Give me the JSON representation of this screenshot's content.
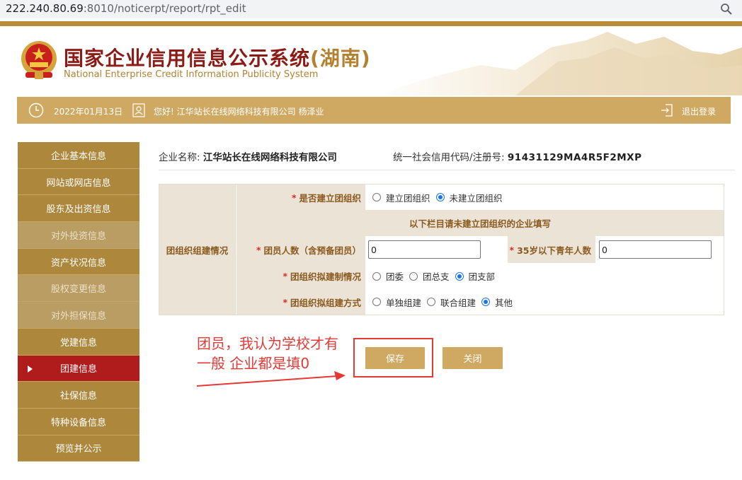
{
  "browser": {
    "url_host": "222.240.80.69",
    "url_path": ":8010/noticerpt/report/rpt_edit"
  },
  "header": {
    "title_main": "国家企业信用信息公示系统",
    "title_province": "(湖南)",
    "subtitle": "National Enterprise Credit Information Publicity System"
  },
  "userbar": {
    "date": "2022年01月13日",
    "greeting": "您好! 江华站长在线网络科技有限公司  杨泽业",
    "logout": "退出登录"
  },
  "sidebar": {
    "items": [
      {
        "label": "企业基本信息"
      },
      {
        "label": "网站或网店信息"
      },
      {
        "label": "股东及出资信息"
      },
      {
        "label": "对外投资信息"
      },
      {
        "label": "资产状况信息"
      },
      {
        "label": "股权变更信息"
      },
      {
        "label": "对外担保信息"
      },
      {
        "label": "党建信息"
      },
      {
        "label": "团建信息"
      },
      {
        "label": "社保信息"
      },
      {
        "label": "特种设备信息"
      },
      {
        "label": "预览并公示"
      }
    ]
  },
  "company": {
    "name_label": "企业名称:",
    "name": "江华站长在线网络科技有限公司",
    "code_label": "统一社会信用代码/注册号:",
    "code": "91431129MA4R5F2MXP"
  },
  "form": {
    "section_title": "团组织组建情况",
    "q1_label": "是否建立团组织",
    "q1_options": [
      "建立团组织",
      "未建立团组织"
    ],
    "q1_selected": "未建立团组织",
    "band_text": "以下栏目请未建立团组织的企业填写",
    "members_label": "团员人数（含预备团员）",
    "members_value": "0",
    "youth_label": "35岁以下青年人数",
    "youth_value": "0",
    "system_label": "团组织拟建制情况",
    "system_options": [
      "团委",
      "团总支",
      "团支部"
    ],
    "system_selected": "团支部",
    "method_label": "团组织拟组建方式",
    "method_options": [
      "单独组建",
      "联合组建",
      "其他"
    ],
    "method_selected": "其他",
    "required_mark": "*"
  },
  "buttons": {
    "save": "保存",
    "close": "关闭"
  },
  "annotation": {
    "line1": "团员，我认为学校才有",
    "line2": "一般 企业都是填0"
  },
  "colors": {
    "gold": "#cfa962",
    "sidebar": "#ad873b",
    "active": "#b01c1c",
    "annotation": "#e53935"
  }
}
